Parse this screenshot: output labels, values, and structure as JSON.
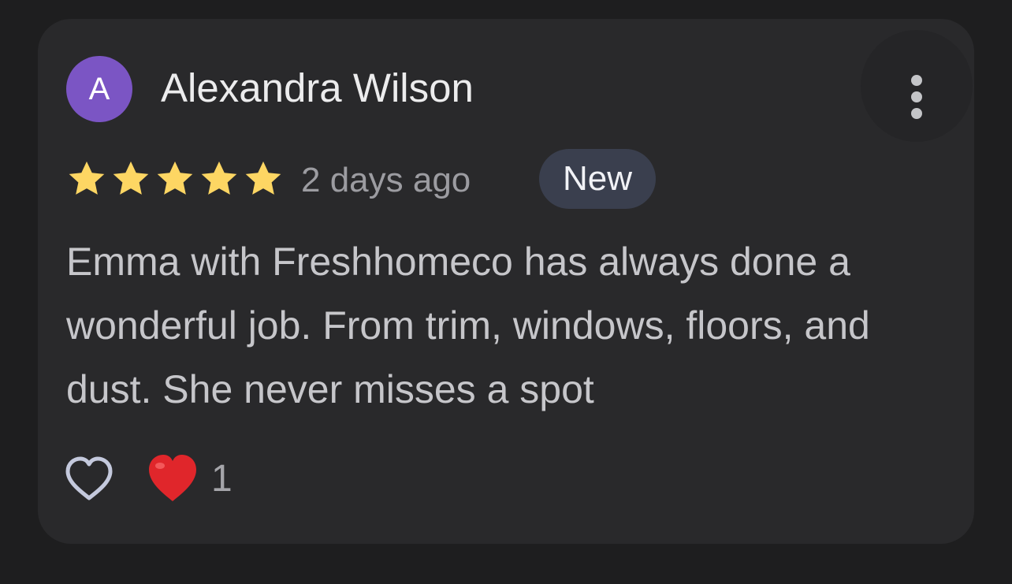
{
  "review": {
    "avatar_initial": "A",
    "author": "Alexandra Wilson",
    "rating": 5,
    "rating_max": 5,
    "date": "2 days ago",
    "badge": "New",
    "text": "Emma with Freshhomeco has always done a wonderful job. From trim, windows, floors, and dust. She never misses a spot",
    "reaction_count": "1"
  },
  "icons": {
    "more": "more-vert-icon",
    "star": "star-icon",
    "like": "heart-outline-icon",
    "reaction": "red-heart-emoji"
  },
  "colors": {
    "background": "#1e1e1f",
    "card": "#29292b",
    "avatar": "#7b55c4",
    "star": "#fdd663",
    "badge": "#3a3f4e",
    "reaction_heart": "#e0262b"
  }
}
